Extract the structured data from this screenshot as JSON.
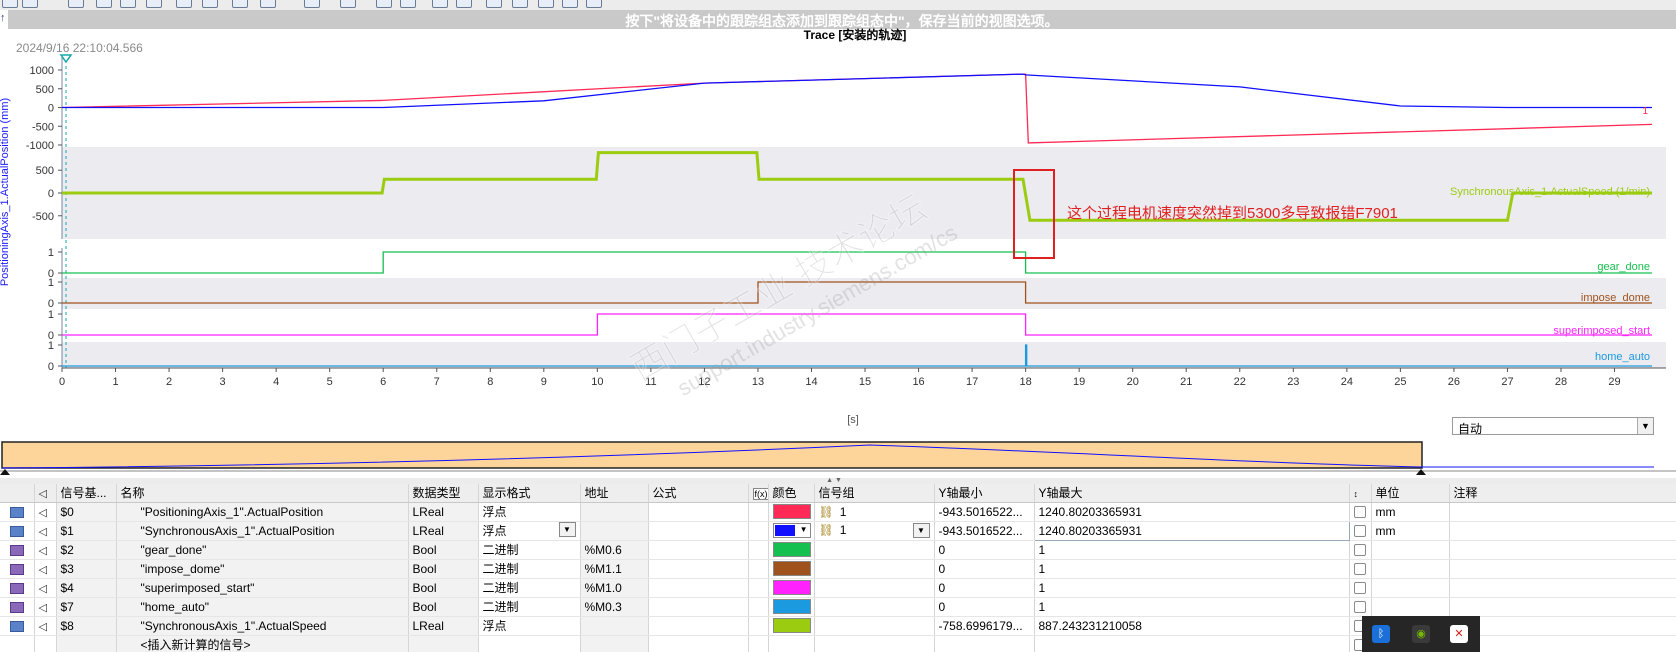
{
  "toolbar": {
    "hint": "按下\"将设备中的跟踪组态添加到跟踪组态中\"，保存当前的视图选项。"
  },
  "trace": {
    "timestamp": "2024/9/16 22:10:04.566",
    "title": "Trace [安装的轨迹]"
  },
  "chart_data": {
    "type": "line",
    "xlabel": "[s]",
    "xlim": [
      0,
      29.7
    ],
    "x_ticks": [
      0,
      1,
      2,
      3,
      4,
      5,
      6,
      7,
      8,
      9,
      10,
      11,
      12,
      13,
      14,
      15,
      16,
      17,
      18,
      19,
      20,
      21,
      22,
      23,
      24,
      25,
      26,
      27,
      28,
      29
    ],
    "annotation": "这个过程电机速度突然掉到5300多导致报错F7901",
    "panes": [
      {
        "ylabel": "PositioningAxis_1.ActualPosition (mm)",
        "yticks": [
          1000,
          500,
          0,
          -500,
          -1000
        ],
        "ylim": [
          -1000,
          1000
        ],
        "series": [
          {
            "name": "",
            "color": "#ff2a55",
            "x": [
              0,
              6,
              12,
              17.95,
              18,
              18.05,
              29.7
            ],
            "y": [
              0,
              190,
              650,
              890,
              890,
              -943,
              -450
            ]
          },
          {
            "name": "",
            "color": "#1010ff",
            "x": [
              0,
              6,
              9,
              12,
              15,
              17.95,
              18,
              22,
              25,
              27,
              29.7
            ],
            "y": [
              0,
              0,
              180,
              650,
              770,
              890,
              870,
              550,
              40,
              0,
              0
            ]
          }
        ]
      },
      {
        "ylabel": "SynchronousAxis_1.ActualSpeed (1/min)",
        "label": "SynchronousAxis_1.ActualSpeed (1/min)",
        "yticks": [
          500,
          0,
          -500
        ],
        "ylim": [
          -900,
          900
        ],
        "series": [
          {
            "name": "SynchronousAxis_1.ActualSpeed (1/min)",
            "color": "#9ccc10",
            "x": [
              0,
              5.98,
              6.02,
              9.98,
              10.02,
              12.98,
              13.02,
              17.95,
              18.08,
              27.0,
              27.1,
              29.7
            ],
            "y": [
              0,
              0,
              300,
              300,
              887,
              887,
              300,
              300,
              -600,
              -600,
              0,
              0
            ]
          }
        ]
      },
      {
        "label": "gear_done",
        "color": "#16c050",
        "yticks": [
          1,
          0
        ],
        "x": [
          0,
          6,
          6,
          18,
          18,
          29.7
        ],
        "y": [
          0,
          0,
          1,
          1,
          0,
          0
        ]
      },
      {
        "label": "impose_dome",
        "color": "#a0521c",
        "yticks": [
          1,
          0
        ],
        "x": [
          0,
          13,
          13,
          18,
          18,
          29.7
        ],
        "y": [
          0,
          0,
          1,
          1,
          0,
          0
        ]
      },
      {
        "label": "superimposed_start",
        "color": "#ff22ff",
        "yticks": [
          1,
          0
        ],
        "x": [
          0,
          10,
          10,
          18,
          18,
          29.7
        ],
        "y": [
          0,
          0,
          1,
          1,
          0,
          0
        ]
      },
      {
        "label": "home_auto",
        "color": "#1c9ae0",
        "yticks": [
          1,
          0
        ],
        "x": [
          0,
          18,
          18,
          18.02,
          18.02,
          29.7
        ],
        "y": [
          0,
          0,
          1,
          1,
          0,
          0
        ]
      }
    ]
  },
  "watermark": {
    "line1": "西门子工业  技术论坛",
    "line2": "support.industry.siemens.com/cs"
  },
  "zoom": {
    "value": "自动"
  },
  "table": {
    "headers": {
      "signal_num": "信号基...",
      "name": "名称",
      "datatype": "数据类型",
      "display_format": "显示格式",
      "address": "地址",
      "formula": "公式",
      "formula_icon": "f(x)",
      "color": "颜色",
      "signal_group": "信号组",
      "ymin": "Y轴最小",
      "ymax": "Y轴最大",
      "unit": "单位",
      "comment": "注释"
    },
    "rows": [
      {
        "num": "$0",
        "name": "\"PositioningAxis_1\".ActualPosition",
        "datatype": "LReal",
        "format": "浮点",
        "address": "",
        "color": "#ff2a55",
        "group": "1",
        "ymin": "-943.5016522...",
        "ymax": "1240.80203365931",
        "unit": "mm"
      },
      {
        "num": "$1",
        "name": "\"SynchronousAxis_1\".ActualPosition",
        "datatype": "LReal",
        "format": "浮点",
        "address": "",
        "color": "#1010ff",
        "group": "1",
        "ymin": "-943.5016522...",
        "ymax": "1240.80203365931",
        "unit": "mm"
      },
      {
        "num": "$2",
        "name": "\"gear_done\"",
        "datatype": "Bool",
        "format": "二进制",
        "address": "%M0.6",
        "color": "#16c050",
        "group": "",
        "ymin": "0",
        "ymax": "1",
        "unit": ""
      },
      {
        "num": "$3",
        "name": "\"impose_dome\"",
        "datatype": "Bool",
        "format": "二进制",
        "address": "%M1.1",
        "color": "#a0521c",
        "group": "",
        "ymin": "0",
        "ymax": "1",
        "unit": ""
      },
      {
        "num": "$4",
        "name": "\"superimposed_start\"",
        "datatype": "Bool",
        "format": "二进制",
        "address": "%M1.0",
        "color": "#ff22ff",
        "group": "",
        "ymin": "0",
        "ymax": "1",
        "unit": ""
      },
      {
        "num": "$7",
        "name": "\"home_auto\"",
        "datatype": "Bool",
        "format": "二进制",
        "address": "%M0.3",
        "color": "#1c9ae0",
        "group": "",
        "ymin": "0",
        "ymax": "1",
        "unit": ""
      },
      {
        "num": "$8",
        "name": "\"SynchronousAxis_1\".ActualSpeed",
        "datatype": "LReal",
        "format": "浮点",
        "address": "",
        "color": "#9ccc10",
        "group": "",
        "ymin": "-758.6996179...",
        "ymax": "887.243231210058",
        "unit": ""
      }
    ],
    "insert_row": "<插入新计算的信号>"
  },
  "tray": {
    "icons": [
      "bluetooth-icon",
      "nvidia-icon",
      "security-icon"
    ]
  }
}
